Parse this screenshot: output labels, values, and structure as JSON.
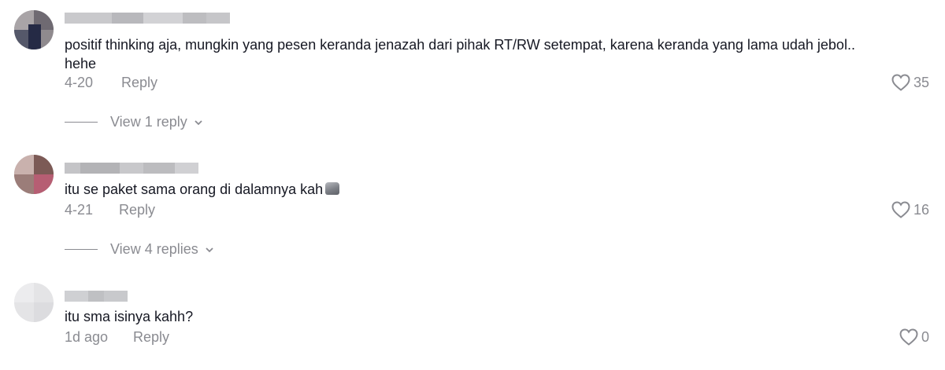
{
  "comments": [
    {
      "text": "positif thinking aja, mungkin yang pesen keranda jenazah dari pihak RT/RW setempat, karena keranda yang lama udah jebol..",
      "text2": "hehe",
      "date": "4-20",
      "reply_label": "Reply",
      "likes": "35",
      "view_replies": "View 1 reply"
    },
    {
      "text": "itu se paket sama orang di dalamnya kah",
      "emoji": "moai-emoji",
      "date": "4-21",
      "reply_label": "Reply",
      "likes": "16",
      "view_replies": "View 4 replies"
    },
    {
      "text": "itu sma isinya kahh?",
      "date": "1d ago",
      "reply_label": "Reply",
      "likes": "0"
    }
  ],
  "colors": {
    "text": "#161823",
    "muted": "#8a8b91",
    "background": "#ffffff"
  },
  "icons": [
    "heart-outline-icon",
    "chevron-down-icon"
  ]
}
